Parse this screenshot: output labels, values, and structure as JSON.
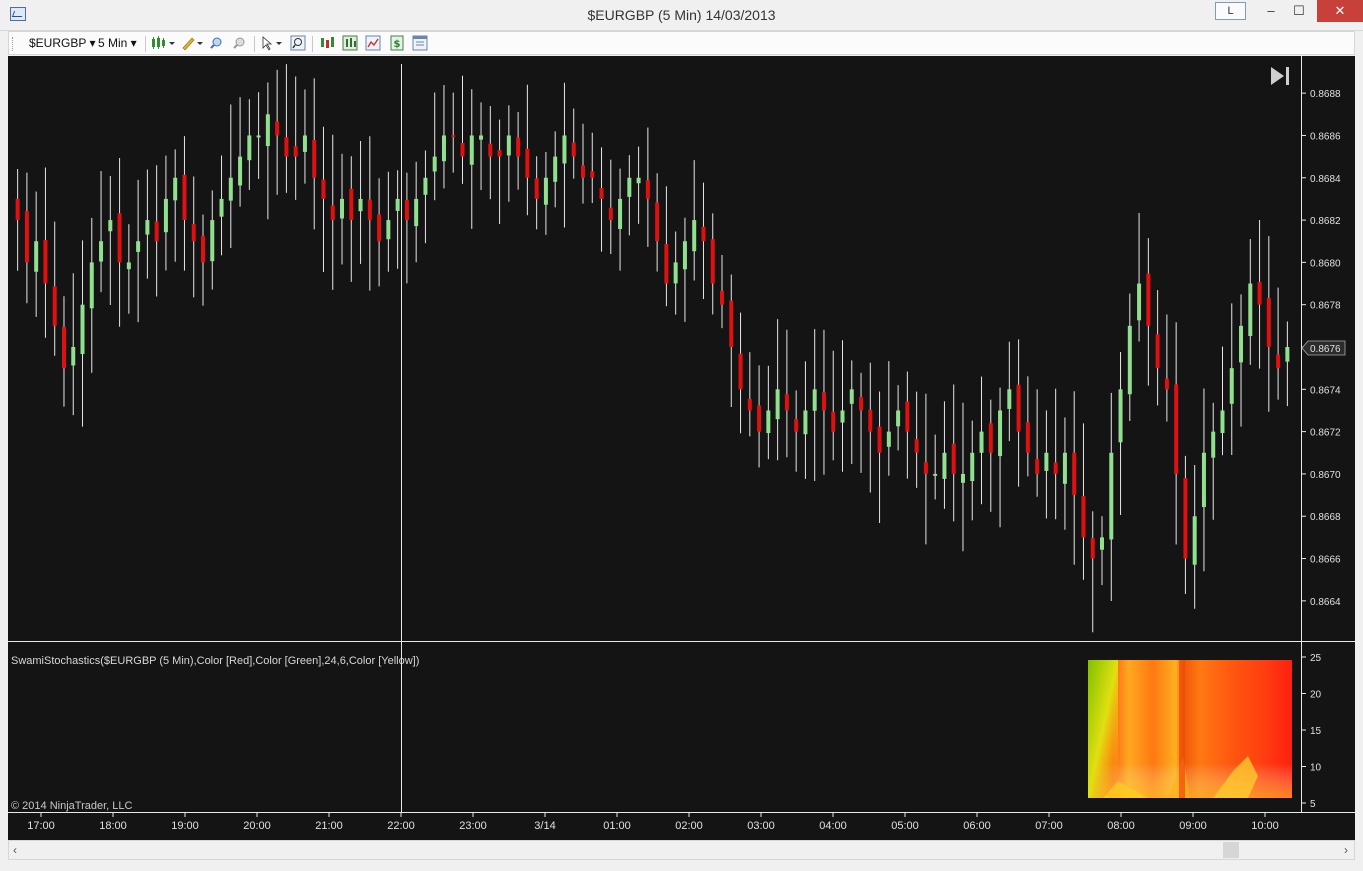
{
  "window": {
    "title": "$EURGBP (5 Min)  14/03/2013",
    "l_button": "L",
    "minimize": "–",
    "maximize": "☐",
    "close": "✕"
  },
  "toolbar": {
    "instrument": "$EURGBP",
    "interval": "5 Min"
  },
  "chart": {
    "last_price": "0.8676",
    "indicator_label": "SwamiStochastics($EURGBP (5 Min),Color [Red],Color [Green],24,6,Color [Yellow])",
    "copyright": "© 2014 NinjaTrader, LLC",
    "colors": {
      "background": "#141414",
      "up": "#90e090",
      "down": "#e01010",
      "wick": "#e6e6e6",
      "grid": "#e8e8e8"
    }
  },
  "chart_data": [
    {
      "type": "candlestick",
      "title": "$EURGBP (5 Min)",
      "x_tick_labels": [
        "17:00",
        "18:00",
        "19:00",
        "20:00",
        "21:00",
        "22:00",
        "23:00",
        "3/14",
        "01:00",
        "02:00",
        "03:00",
        "04:00",
        "05:00",
        "06:00",
        "07:00",
        "08:00",
        "09:00",
        "10:00"
      ],
      "y_tick_labels": [
        "0.8688",
        "0.8686",
        "0.8684",
        "0.8682",
        "0.8680",
        "0.8678",
        "0.8676",
        "0.8674",
        "0.8672",
        "0.8670",
        "0.8668",
        "0.8666",
        "0.8664"
      ],
      "ylim": [
        0.8663,
        0.8689
      ],
      "last_value": 0.8676,
      "series": [
        {
          "name": "$EURGBP",
          "close": [
            0.8682,
            0.868,
            0.8681,
            0.8679,
            0.8677,
            0.8675,
            0.8676,
            0.8678,
            0.868,
            0.8681,
            0.8682,
            0.868,
            0.868,
            0.8681,
            0.8682,
            0.8681,
            0.8683,
            0.8684,
            0.8682,
            0.8681,
            0.868,
            0.8682,
            0.8683,
            0.8684,
            0.8685,
            0.8686,
            0.8686,
            0.8687,
            0.8686,
            0.8685,
            0.8685,
            0.8686,
            0.8684,
            0.8683,
            0.8682,
            0.8683,
            0.8682,
            0.8683,
            0.8682,
            0.8681,
            0.8682,
            0.8683,
            0.8682,
            0.8683,
            0.8684,
            0.8685,
            0.8686,
            0.8686,
            0.8685,
            0.8686,
            0.8686,
            0.8685,
            0.8685,
            0.8686,
            0.8685,
            0.8684,
            0.8683,
            0.8684,
            0.8685,
            0.8686,
            0.8685,
            0.8684,
            0.8684,
            0.8683,
            0.8682,
            0.8683,
            0.8684,
            0.8684,
            0.8683,
            0.8681,
            0.8679,
            0.868,
            0.8681,
            0.8682,
            0.8681,
            0.8679,
            0.8678,
            0.8676,
            0.8674,
            0.8673,
            0.8672,
            0.8673,
            0.8674,
            0.8673,
            0.8672,
            0.8673,
            0.8674,
            0.8673,
            0.8672,
            0.8673,
            0.8674,
            0.8673,
            0.8672,
            0.8671,
            0.8672,
            0.8673,
            0.8672,
            0.8671,
            0.867,
            0.867,
            0.8671,
            0.867,
            0.867,
            0.8671,
            0.8672,
            0.8671,
            0.8673,
            0.8674,
            0.8672,
            0.8671,
            0.867,
            0.8671,
            0.867,
            0.8671,
            0.8669,
            0.8667,
            0.8666,
            0.8667,
            0.8671,
            0.8674,
            0.8677,
            0.8679,
            0.8677,
            0.8675,
            0.8674,
            0.867,
            0.8666,
            0.8668,
            0.8671,
            0.8672,
            0.8673,
            0.8675,
            0.8677,
            0.8679,
            0.8678,
            0.8676,
            0.8675,
            0.8676
          ]
        }
      ]
    },
    {
      "type": "heatmap",
      "title": "SwamiStochastics($EURGBP (5 Min),Color [Red],Color [Green],24,6,Color [Yellow])",
      "y_tick_labels": [
        "25",
        "20",
        "15",
        "10",
        "5"
      ],
      "ylim": [
        5,
        25
      ]
    }
  ]
}
